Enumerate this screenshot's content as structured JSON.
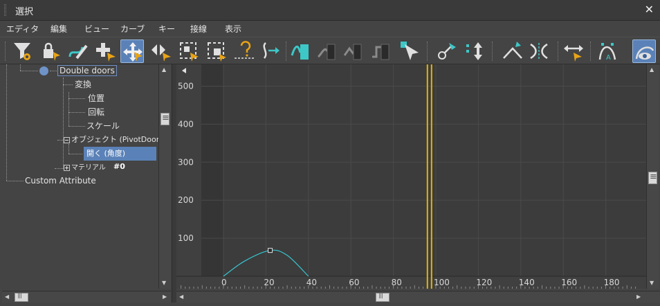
{
  "window": {
    "title": "選択",
    "close_glyph": "✕"
  },
  "menu": [
    "エディタ",
    "編集",
    "ビュー",
    "カーブ",
    "キー",
    "接線",
    "表示"
  ],
  "toolbar": {
    "icons": [
      "filter-icon",
      "lock-key-icon",
      "edit-curve-icon",
      "add-key-icon",
      "move-keys-icon",
      "slide-keys-icon",
      "scale-keys-icon",
      "scale-values-icon",
      "key-question-icon",
      "out-of-range-icon",
      "curve-auto-icon",
      "curve-flat-icon",
      "curve-linear-icon",
      "curve-step-icon",
      "select-cursor-icon",
      "set-key-icon",
      "move-vertical-icon",
      "tangent-break-icon",
      "tangent-unify-icon",
      "lock-tangents-icon",
      "frame-horizontal-icon",
      "normalize-icon",
      "show-tangents-icon"
    ],
    "active_icons": [
      "move-keys-icon",
      "show-tangents-icon"
    ],
    "accent": "#3ec7c7",
    "key_color": "#e8a317"
  },
  "tree": {
    "items": [
      "Double doors",
      "変換",
      "位置",
      "回転",
      "スケール",
      "オブジェクト (PivotDoor)",
      "開く (角度)",
      "マテリアル",
      "#0",
      "Custom Attribute"
    ],
    "selected_index": 6
  },
  "chart_data": {
    "type": "line",
    "x_ticks": [
      0,
      20,
      40,
      60,
      80,
      100,
      120,
      140,
      160,
      180
    ],
    "y_ticks": [
      100,
      200,
      300,
      400,
      500
    ],
    "xlim": [
      -5,
      195
    ],
    "ylim": [
      0,
      545
    ],
    "series": [
      {
        "x": [
          0,
          10,
          22,
          30,
          40
        ],
        "y": [
          0,
          40,
          68,
          55,
          0
        ]
      }
    ],
    "key": {
      "x": 22,
      "y": 68
    },
    "time_slider": 97,
    "curve_color": "#37c6d2",
    "slider_color": "#e8b400",
    "grid": true
  }
}
